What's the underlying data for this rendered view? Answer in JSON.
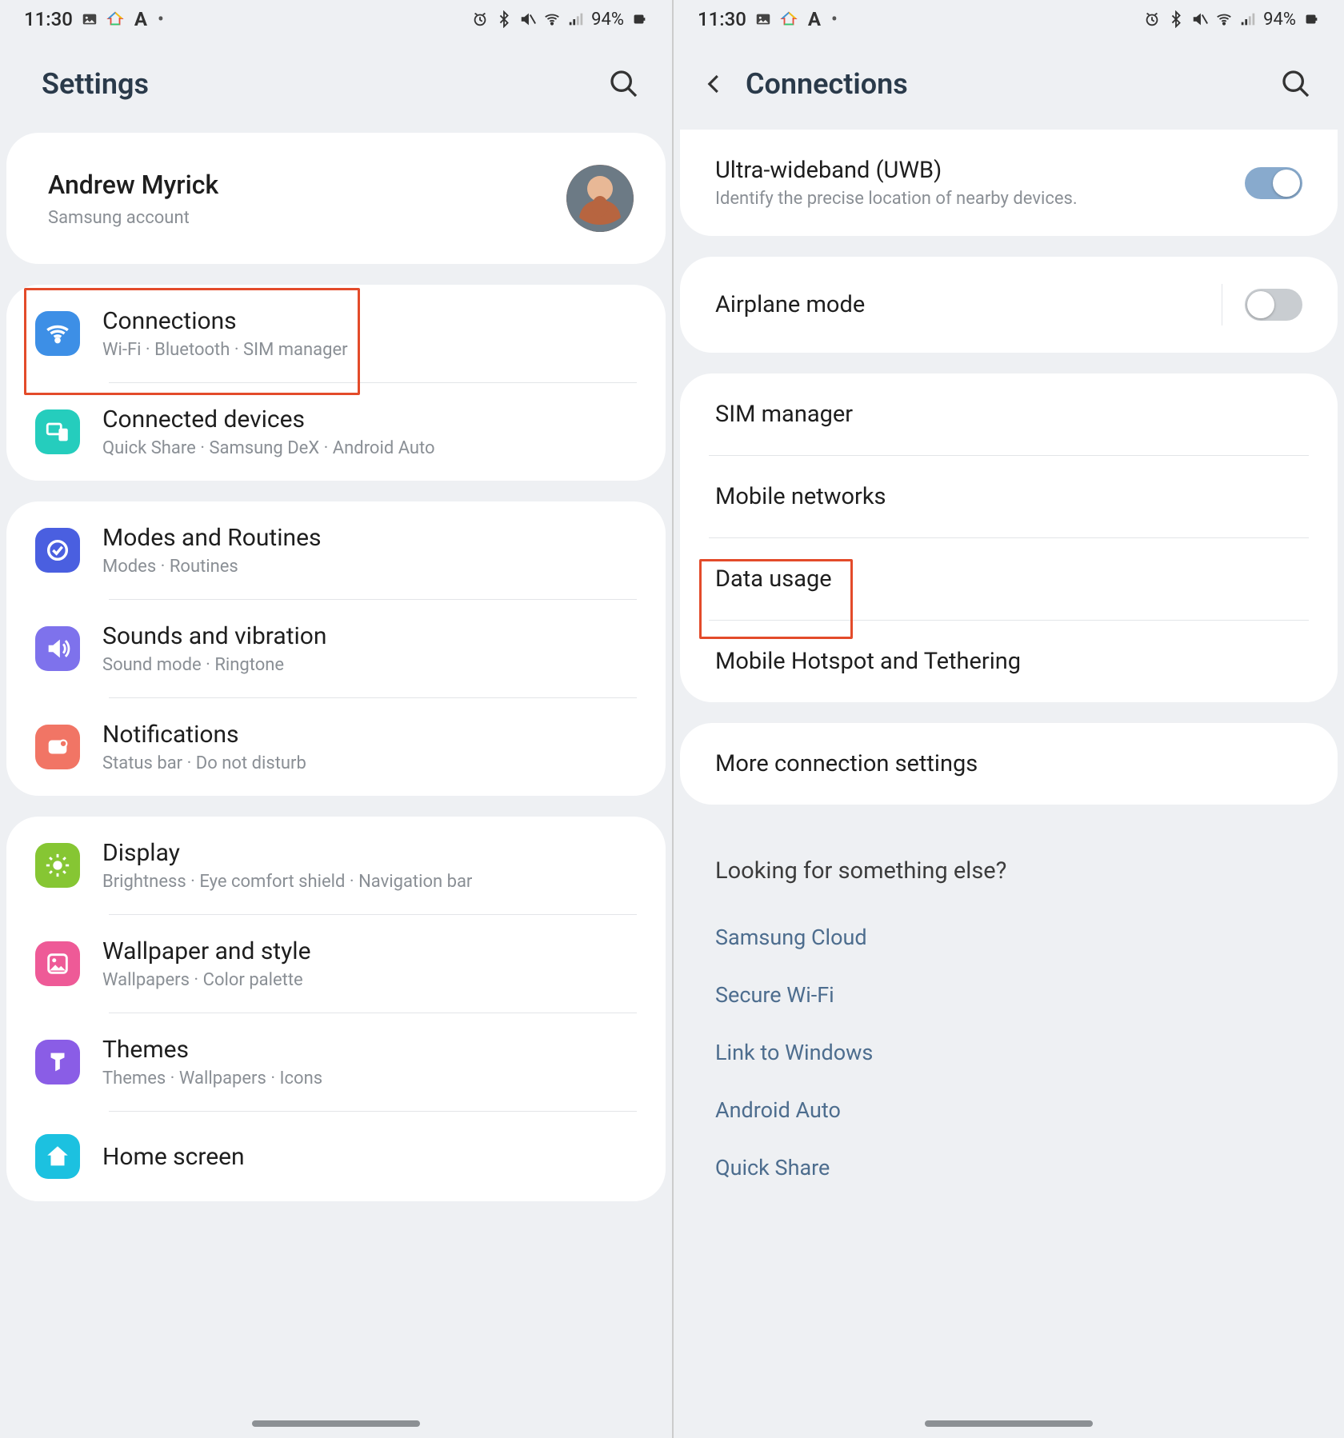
{
  "status": {
    "time": "11:30",
    "battery": "94%"
  },
  "left": {
    "title": "Settings",
    "account": {
      "name": "Andrew Myrick",
      "sub": "Samsung account"
    },
    "groups": [
      {
        "items": [
          {
            "icon": "wifi",
            "color": "bg-blue",
            "title": "Connections",
            "sub": "Wi-Fi · Bluetooth · SIM manager"
          },
          {
            "icon": "devices",
            "color": "bg-teal",
            "title": "Connected devices",
            "sub": "Quick Share · Samsung DeX · Android Auto"
          }
        ]
      },
      {
        "items": [
          {
            "icon": "routines",
            "color": "bg-indigo",
            "title": "Modes and Routines",
            "sub": "Modes · Routines"
          },
          {
            "icon": "sound",
            "color": "bg-purple",
            "title": "Sounds and vibration",
            "sub": "Sound mode · Ringtone"
          },
          {
            "icon": "notif",
            "color": "bg-coral",
            "title": "Notifications",
            "sub": "Status bar · Do not disturb"
          }
        ]
      },
      {
        "items": [
          {
            "icon": "display",
            "color": "bg-green",
            "title": "Display",
            "sub": "Brightness · Eye comfort shield · Navigation bar"
          },
          {
            "icon": "wallpaper",
            "color": "bg-pink",
            "title": "Wallpaper and style",
            "sub": "Wallpapers · Color palette"
          },
          {
            "icon": "themes",
            "color": "bg-violet",
            "title": "Themes",
            "sub": "Themes · Wallpapers · Icons"
          },
          {
            "icon": "home",
            "color": "bg-cyan",
            "title": "Home screen",
            "sub": ""
          }
        ]
      }
    ]
  },
  "right": {
    "title": "Connections",
    "uwb": {
      "title": "Ultra-wideband (UWB)",
      "sub": "Identify the precise location of nearby devices."
    },
    "airplane": {
      "title": "Airplane mode"
    },
    "items": [
      "SIM manager",
      "Mobile networks",
      "Data usage",
      "Mobile Hotspot and Tethering"
    ],
    "more": "More connection settings",
    "looking_title": "Looking for something else?",
    "looking_links": [
      "Samsung Cloud",
      "Secure Wi-Fi",
      "Link to Windows",
      "Android Auto",
      "Quick Share"
    ]
  }
}
